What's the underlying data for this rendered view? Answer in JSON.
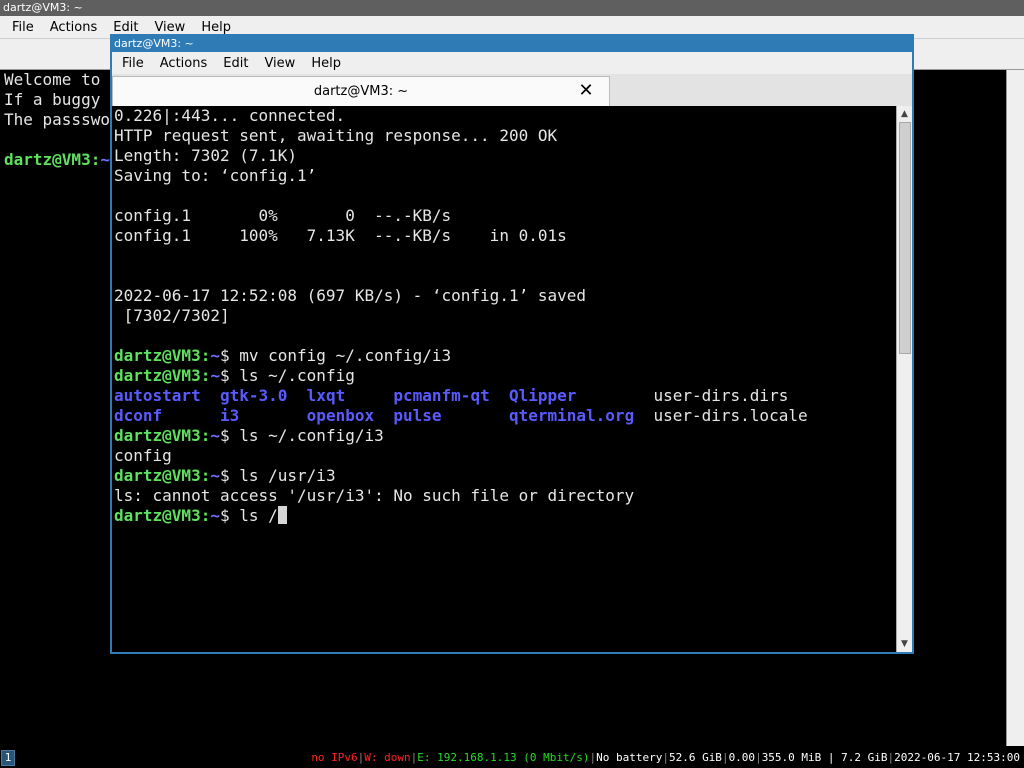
{
  "back_window": {
    "title": "dartz@VM3: ~",
    "menu": [
      "File",
      "Actions",
      "Edit",
      "View",
      "Help"
    ],
    "lines": [
      "Welcome to",
      "If a buggy",
      "The passswo",
      ""
    ],
    "prompt_user": "dartz@VM3:",
    "prompt_path": "~"
  },
  "front_window": {
    "title": "dartz@VM3: ~",
    "menu": [
      "File",
      "Actions",
      "Edit",
      "View",
      "Help"
    ],
    "tab_label": "dartz@VM3: ~",
    "close_glyph": "✕",
    "prompt_user": "dartz@VM3:",
    "prompt_path": "~",
    "terminal_lines": [
      {
        "text": "0.226|:443... connected."
      },
      {
        "text": "HTTP request sent, awaiting response... 200 OK"
      },
      {
        "text": "Length: 7302 (7.1K)"
      },
      {
        "text": "Saving to: ‘config.1’"
      },
      {
        "text": ""
      },
      {
        "text": "config.1       0%       0  --.-KB/s"
      },
      {
        "text": "config.1     100%   7.13K  --.-KB/s    in 0.01s"
      },
      {
        "text": ""
      },
      {
        "text": ""
      },
      {
        "text": "2022-06-17 12:52:08 (697 KB/s) - ‘config.1’ saved"
      },
      {
        "text": " [7302/7302]"
      },
      {
        "text": ""
      },
      {
        "prompt": true,
        "cmd": " mv config ~/.config/i3"
      },
      {
        "prompt": true,
        "cmd": " ls ~/.config"
      },
      {
        "ls": [
          "autostart  ",
          "gtk-3.0  ",
          "lxqt     ",
          "pcmanfm-qt  ",
          "Qlipper        ",
          "user-dirs.dirs"
        ]
      },
      {
        "ls": [
          "dconf      ",
          "i3       ",
          "openbox  ",
          "pulse       ",
          "qterminal.org  ",
          "user-dirs.locale"
        ]
      },
      {
        "prompt": true,
        "cmd": " ls ~/.config/i3"
      },
      {
        "text": "config"
      },
      {
        "prompt": true,
        "cmd": " ls /usr/i3"
      },
      {
        "text": "ls: cannot access '/usr/i3': No such file or directory"
      },
      {
        "prompt": true,
        "cmd": " ls /",
        "cursor": true
      }
    ]
  },
  "statusbar": {
    "workspace": "1",
    "ipv6": "no IPv6",
    "wifi": "W: down",
    "ethernet": "E: 192.168.1.13 (0 Mbit/s)",
    "battery": "No battery",
    "disk": "52.6 GiB",
    "load": "0.00",
    "memory": "355.0 MiB | 7.2 GiB",
    "datetime": "2022-06-17 12:53:00"
  }
}
